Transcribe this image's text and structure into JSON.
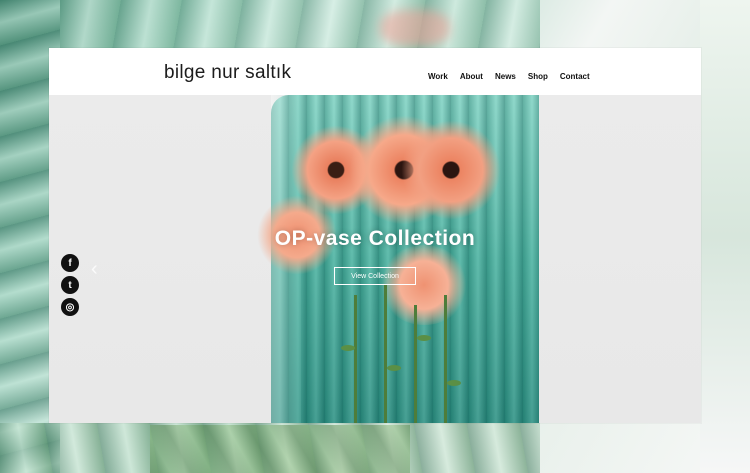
{
  "site": {
    "logo": "bilge nur saltık"
  },
  "nav": {
    "items": [
      {
        "label": "Work"
      },
      {
        "label": "About"
      },
      {
        "label": "News"
      },
      {
        "label": "Shop"
      },
      {
        "label": "Contact"
      }
    ]
  },
  "hero": {
    "title": "OP-vase Collection",
    "button_label": "View Collection",
    "prev_arrow": "‹"
  },
  "social": {
    "facebook_glyph": "f",
    "twitter_glyph": "t",
    "instagram_glyph": "◎"
  },
  "colors": {
    "accent": "#ffffff",
    "vase": "#4fb0a0",
    "flower": "#f08f6f"
  }
}
